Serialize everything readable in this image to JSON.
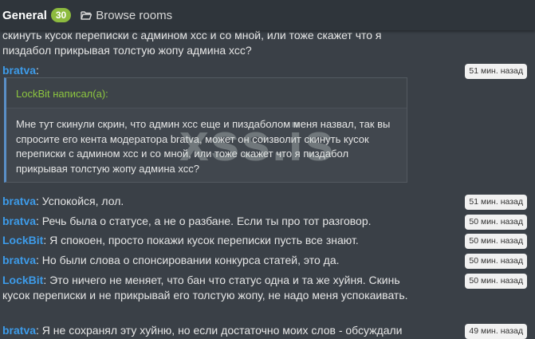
{
  "header": {
    "room": "General",
    "count": "30",
    "browse": "Browse rooms"
  },
  "messages": [
    {
      "text": "скинуть кусок переписки с админом хсс и со мной, или тоже скажет что я пиздабол прикрывая толстую жопу админа хсс?"
    },
    {
      "author": "bratva",
      "text": ":",
      "time": "51 мин. назад",
      "quote": {
        "author": "LockBit написал(а):",
        "text": "Мне тут скинули скрин, что админ хсс еще и пиздаболом меня назвал, так вы спросите его кента модератора bratva, может он соизволит скинуть кусок переписки с админом хсс и со мной, или тоже скажет что я пиздабол прикрывая толстую жопу админа хсс?"
      }
    },
    {
      "author": "bratva",
      "text": ": Успокойся, лол.",
      "time": "51 мин. назад"
    },
    {
      "author": "bratva",
      "text": ": Речь была о статусе, а не о разбане. Если ты про тот разговор.",
      "time": "50 мин. назад"
    },
    {
      "author": "LockBit",
      "text": ": Я спокоен, просто покажи кусок переписки пусть все знают.",
      "time": "50 мин. назад"
    },
    {
      "author": "bratva",
      "text": ": Но были слова о спонсировании конкурса статей, это да.",
      "time": "50 мин. назад"
    },
    {
      "author": "LockBit",
      "text": ": Это ничего не меняет, что бан что статус одна и та же хуйня. Скинь кусок переписки и не прикрывай его толстую жопу, не надо меня успокаивать.",
      "time": "50 мин. назад"
    },
    {
      "author": "bratva",
      "text": ": Я не сохранял эту хуйню, но если достаточно моих слов - обсуждали",
      "time": "49 мин. назад"
    }
  ],
  "watermark": "xss.is"
}
